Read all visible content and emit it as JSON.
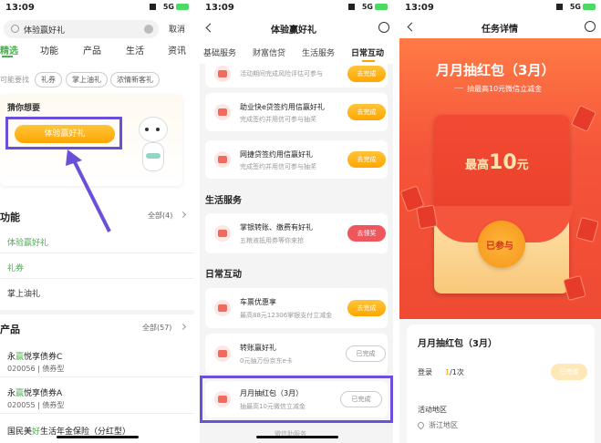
{
  "p1": {
    "status_time": "13:09",
    "status_net": "5G",
    "search_placeholder": "体验赢好礼",
    "cancel": "取消",
    "tabs": [
      "精选",
      "功能",
      "产品",
      "生活",
      "资讯"
    ],
    "maybe_label": "可能要找",
    "chips": [
      "礼券",
      "掌上油礼",
      "浓情新客礼"
    ],
    "guess_title": "猜你想要",
    "guess_button": "体验赢好礼",
    "func_title": "功能",
    "func_all": "全部(4)",
    "func_items": [
      "体验赢好礼",
      "礼券",
      "掌上油礼"
    ],
    "prod_title": "产品",
    "prod_all": "全部(57)",
    "products": [
      {
        "name_pre": "永",
        "name_hl": "赢",
        "name_post": "悦享债券C",
        "code": "020056 | 债券型"
      },
      {
        "name_pre": "永",
        "name_hl": "赢",
        "name_post": "悦享债券A",
        "code": "020055 | 债券型"
      }
    ],
    "last_pre": "国民美",
    "last_hl": "好",
    "last_post": "生活年金保险（分红型）"
  },
  "p2": {
    "status_time": "13:09",
    "status_net": "5G",
    "title": "体验赢好礼",
    "tabs": [
      "基础服务",
      "财富信贷",
      "生活服务",
      "日常互动"
    ],
    "top_partial_sub": "活动期间完成风险评估可参与",
    "top_partial_btn": "去完成",
    "items1": [
      {
        "title": "助业快e贷签约用信赢好礼",
        "sub": "完成签约并用信可参与抽奖",
        "btn": "去完成"
      },
      {
        "title": "网捷贷签约用信赢好礼",
        "sub": "完成签约并用信可参与抽奖",
        "btn": "去完成"
      }
    ],
    "life_title": "生活服务",
    "life_item": {
      "title": "掌银转账、缴费有好礼",
      "sub": "五粮液抵用券等你来抢",
      "btn": "去领奖"
    },
    "daily_title": "日常互动",
    "daily": [
      {
        "title": "车票优惠享",
        "sub": "最高88元12306掌银支付立减金",
        "btn": "去完成"
      },
      {
        "title": "转账赢好礼",
        "sub": "0元抽万份京东e卡",
        "btn": "已完成"
      },
      {
        "title": "月月抽红包（3月）",
        "sub": "抽最高10元微信立减金",
        "btn": "已完成"
      }
    ],
    "bottom_partial": "微信助服务"
  },
  "p3": {
    "status_time": "13:09",
    "status_net": "5G",
    "title": "任务详情",
    "banner_title": "月月抽红包（3月）",
    "banner_sub": "抽最高10元微信立减金",
    "envelope_pre": "最高",
    "envelope_num": "10",
    "envelope_unit": "元",
    "seal": "已参与",
    "card_title": "月月抽红包（3月）",
    "login_label": "登录",
    "login_progress_done": "1",
    "login_progress_rest": "/1次",
    "done_btn": "已完成",
    "area_label": "活动地区",
    "area_value": "浙江地区"
  },
  "colors": {
    "accent": "#ff9f0a",
    "red": "#f0575d",
    "purple": "#6b4fd8",
    "banner": "#f5553a"
  }
}
